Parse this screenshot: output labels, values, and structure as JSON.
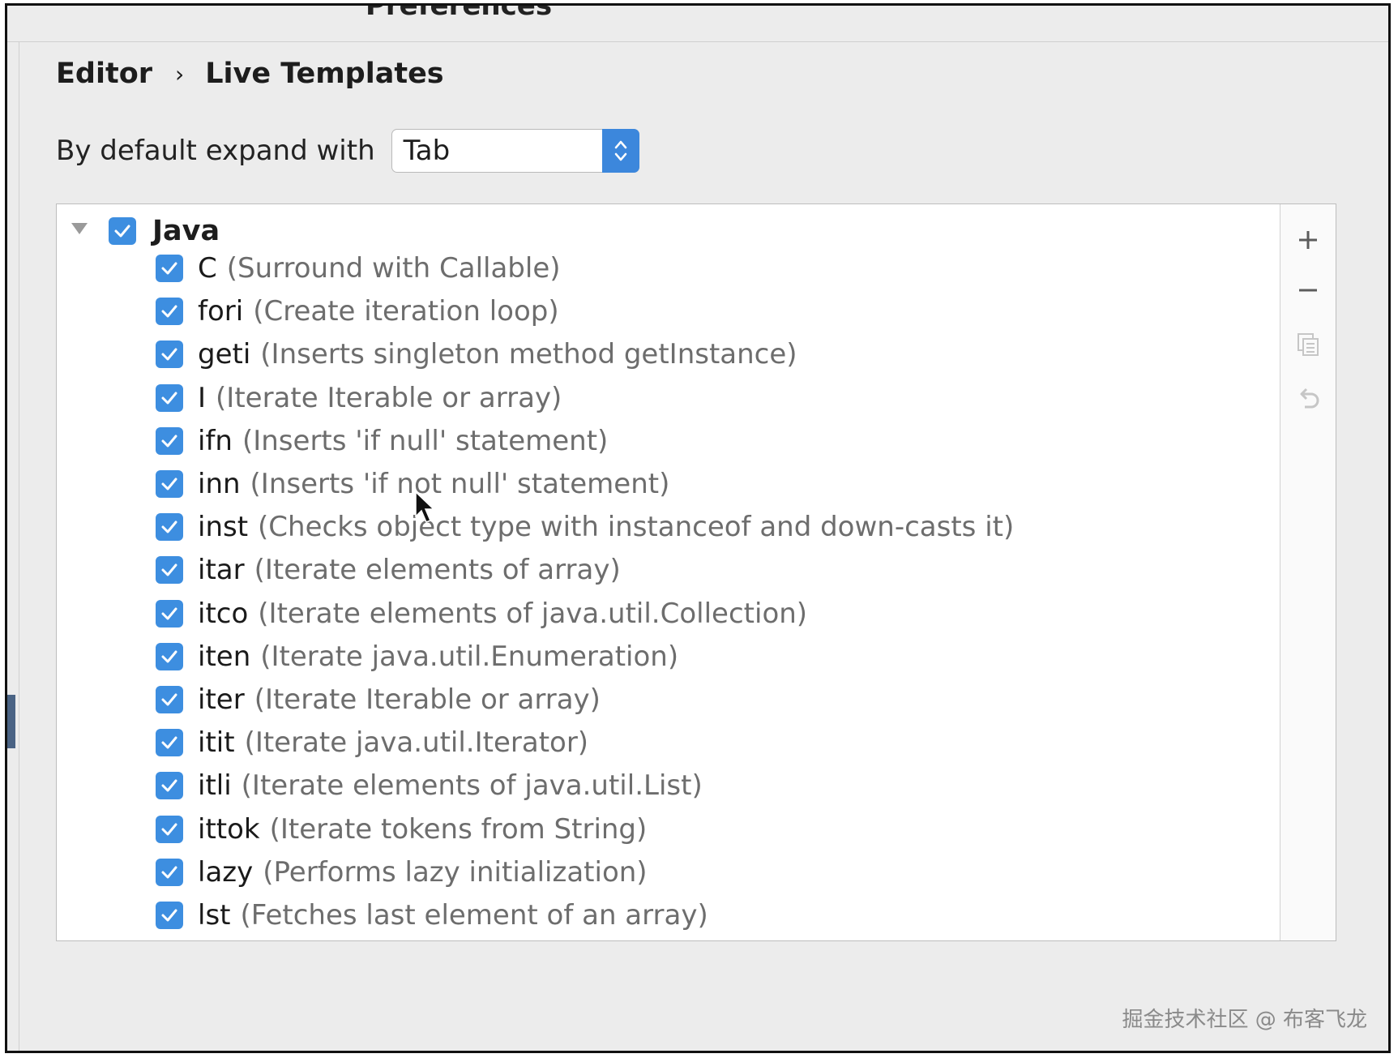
{
  "window": {
    "title": "Preferences"
  },
  "breadcrumb": {
    "parent": "Editor",
    "separator": "›",
    "current": "Live Templates"
  },
  "expand": {
    "label": "By default expand with",
    "value": "Tab"
  },
  "tree": {
    "group": {
      "name": "Java",
      "checked": true,
      "expanded": true
    },
    "items": [
      {
        "abbr": "C",
        "desc": "(Surround with Callable)",
        "checked": true
      },
      {
        "abbr": "fori",
        "desc": "(Create iteration loop)",
        "checked": true
      },
      {
        "abbr": "geti",
        "desc": "(Inserts singleton method getInstance)",
        "checked": true
      },
      {
        "abbr": "I",
        "desc": "(Iterate Iterable or array)",
        "checked": true
      },
      {
        "abbr": "ifn",
        "desc": "(Inserts 'if null' statement)",
        "checked": true
      },
      {
        "abbr": "inn",
        "desc": "(Inserts 'if not null' statement)",
        "checked": true
      },
      {
        "abbr": "inst",
        "desc": "(Checks object type with instanceof and down-casts it)",
        "checked": true
      },
      {
        "abbr": "itar",
        "desc": "(Iterate elements of array)",
        "checked": true
      },
      {
        "abbr": "itco",
        "desc": "(Iterate elements of java.util.Collection)",
        "checked": true
      },
      {
        "abbr": "iten",
        "desc": "(Iterate java.util.Enumeration)",
        "checked": true
      },
      {
        "abbr": "iter",
        "desc": "(Iterate Iterable or array)",
        "checked": true
      },
      {
        "abbr": "itit",
        "desc": "(Iterate java.util.Iterator)",
        "checked": true
      },
      {
        "abbr": "itli",
        "desc": "(Iterate elements of java.util.List)",
        "checked": true
      },
      {
        "abbr": "ittok",
        "desc": "(Iterate tokens from String)",
        "checked": true
      },
      {
        "abbr": "lazy",
        "desc": "(Performs lazy initialization)",
        "checked": true
      },
      {
        "abbr": "lst",
        "desc": "(Fetches last element of an array)",
        "checked": true
      }
    ]
  },
  "toolbar": {
    "icons": [
      "plus-icon",
      "minus-icon",
      "copy-icon",
      "restore-icon"
    ]
  },
  "watermark": {
    "text": "掘金技术社区 @ 布客飞龙"
  },
  "colors": {
    "accent": "#3d8ee0",
    "select_button": "#3c87dc"
  }
}
